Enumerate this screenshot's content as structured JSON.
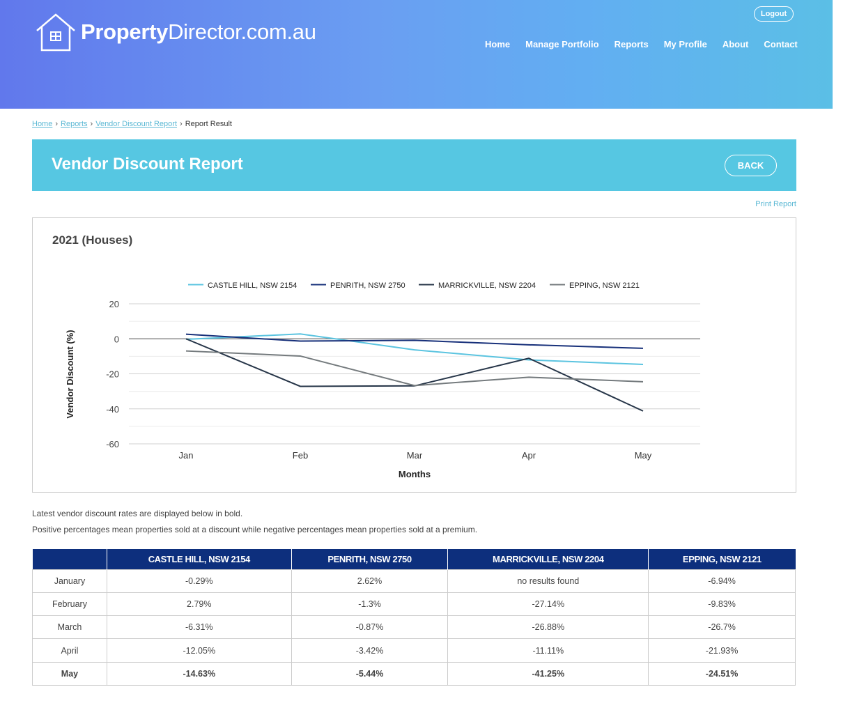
{
  "header": {
    "logo_bold": "Property",
    "logo_regular": "Director.com.au",
    "logout_label": "Logout",
    "nav": [
      "Home",
      "Manage Portfolio",
      "Reports",
      "My Profile",
      "About",
      "Contact"
    ]
  },
  "breadcrumb": {
    "items": [
      "Home",
      "Reports",
      "Vendor Discount Report"
    ],
    "current": "Report Result"
  },
  "page": {
    "title": "Vendor Discount Report",
    "back_label": "BACK",
    "print_label": "Print Report"
  },
  "colors": {
    "castle_hill": "#5bc4e0",
    "penrith": "#17307a",
    "marrickville": "#263548",
    "epping": "#747a7d",
    "table_header": "#0d2f7d",
    "title_bar": "#56c7e2"
  },
  "chart_data": {
    "type": "line",
    "title": "2021 (Houses)",
    "xlabel": "Months",
    "ylabel": "Vendor Discount (%)",
    "categories": [
      "Jan",
      "Feb",
      "Mar",
      "Apr",
      "May"
    ],
    "ylim": [
      -60,
      20
    ],
    "yticks": [
      20,
      0,
      -20,
      -40,
      -60
    ],
    "grid": true,
    "legend": "top",
    "series": [
      {
        "name": "CASTLE HILL, NSW 2154",
        "values": [
          -0.29,
          2.79,
          -6.31,
          -12.05,
          -14.63
        ]
      },
      {
        "name": "PENRITH, NSW 2750",
        "values": [
          2.62,
          -1.3,
          -0.87,
          -3.42,
          -5.44
        ]
      },
      {
        "name": "MARRICKVILLE, NSW 2204",
        "values": [
          0,
          -27.14,
          -26.88,
          -11.11,
          -41.25
        ]
      },
      {
        "name": "EPPING, NSW 2121",
        "values": [
          -6.94,
          -9.83,
          -26.7,
          -21.93,
          -24.51
        ]
      }
    ]
  },
  "notes": [
    "Latest vendor discount rates are displayed below in bold.",
    "Positive percentages mean properties sold at a discount while negative percentages mean properties sold at a premium."
  ],
  "table": {
    "headers": [
      "",
      "CASTLE HILL, NSW 2154",
      "PENRITH, NSW 2750",
      "MARRICKVILLE, NSW 2204",
      "EPPING, NSW 2121"
    ],
    "rows": [
      [
        "January",
        "-0.29%",
        "2.62%",
        "no results found",
        "-6.94%"
      ],
      [
        "February",
        "2.79%",
        "-1.3%",
        "-27.14%",
        "-9.83%"
      ],
      [
        "March",
        "-6.31%",
        "-0.87%",
        "-26.88%",
        "-26.7%"
      ],
      [
        "April",
        "-12.05%",
        "-3.42%",
        "-11.11%",
        "-21.93%"
      ],
      [
        "May",
        "-14.63%",
        "-5.44%",
        "-41.25%",
        "-24.51%"
      ]
    ]
  }
}
